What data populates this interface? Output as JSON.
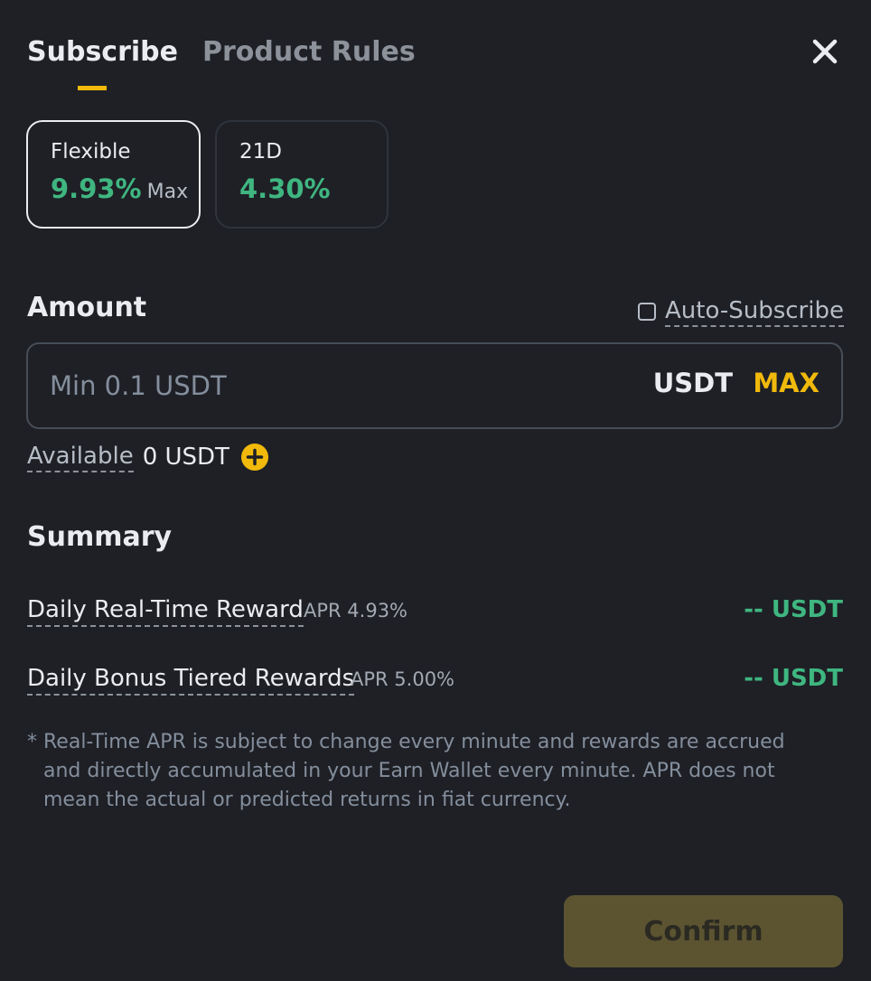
{
  "tabs": {
    "subscribe": "Subscribe",
    "product_rules": "Product Rules"
  },
  "products": [
    {
      "label": "Flexible",
      "rate": "9.93%",
      "suffix": "Max",
      "selected": true
    },
    {
      "label": "21D",
      "rate": "4.30%",
      "suffix": "",
      "selected": false
    }
  ],
  "amount": {
    "title": "Amount",
    "auto_subscribe_label": "Auto-Subscribe",
    "auto_subscribe_checked": false,
    "input_value": "",
    "input_placeholder": "Min 0.1 USDT",
    "unit": "USDT",
    "max_label": "MAX"
  },
  "available": {
    "label": "Available",
    "value": "0 USDT"
  },
  "summary": {
    "title": "Summary",
    "rows": [
      {
        "label": "Daily Real-Time Reward",
        "apr": "APR 4.93%",
        "value": "-- USDT"
      },
      {
        "label": "Daily Bonus Tiered Rewards",
        "apr": "APR 5.00%",
        "value": "-- USDT"
      }
    ],
    "note_marker": "*",
    "note": "Real-Time APR is subject to change every minute and rewards are accrued and directly accumulated in your Earn Wallet every minute. APR does not mean the actual or predicted returns in fiat currency."
  },
  "confirm_label": "Confirm",
  "icons": {
    "close": "close-icon",
    "add_funds": "plus-circle-icon"
  },
  "colors": {
    "background": "#1e2026",
    "accent": "#f0b90b",
    "positive": "#3fb680",
    "confirm_disabled": "#5c5431"
  }
}
